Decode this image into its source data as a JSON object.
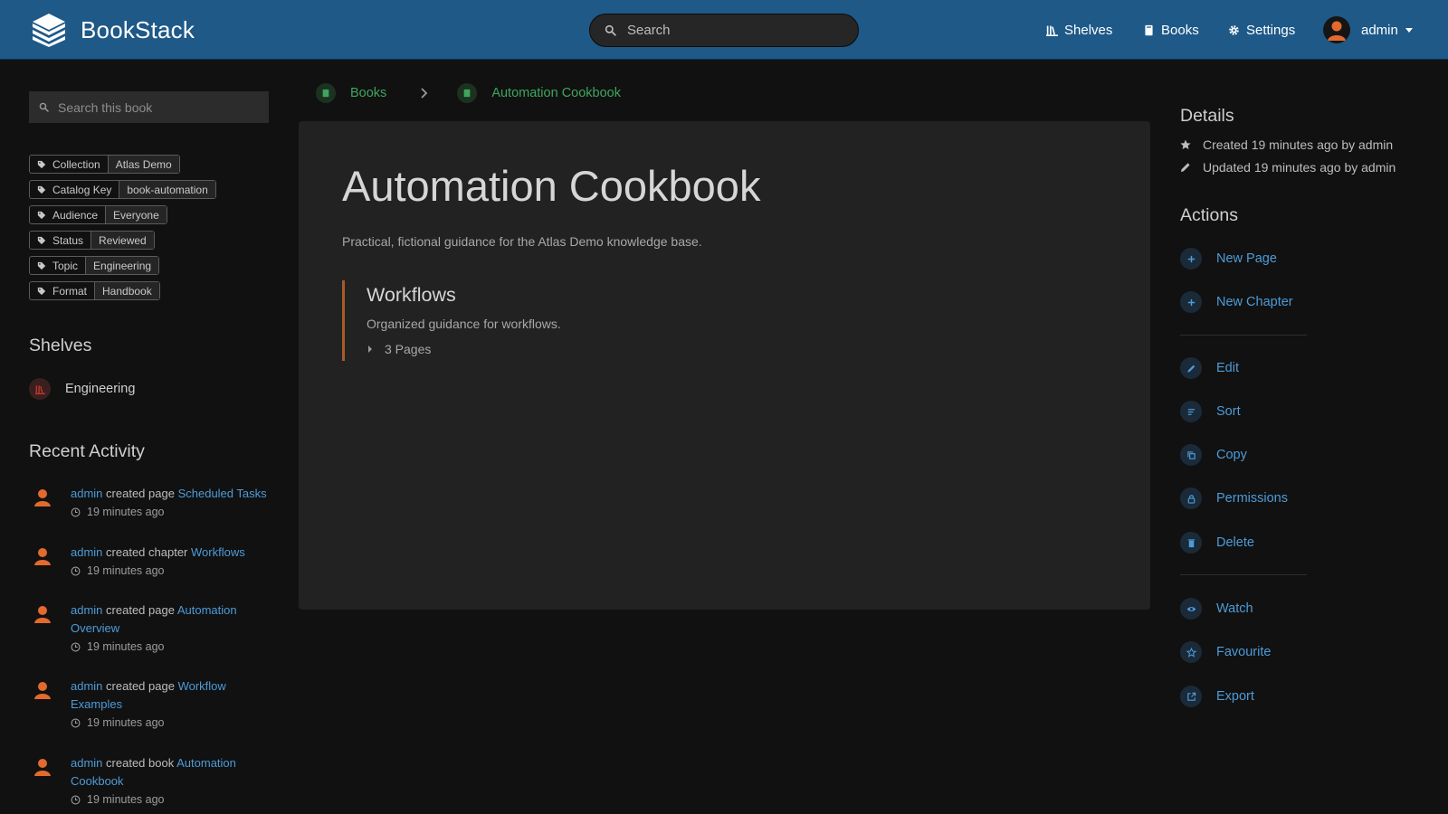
{
  "header": {
    "app_name": "BookStack",
    "search_placeholder": "Search",
    "nav": {
      "shelves": "Shelves",
      "books": "Books",
      "settings": "Settings"
    },
    "user": "admin"
  },
  "left": {
    "search_placeholder": "Search this book",
    "tags": [
      {
        "name": "Collection",
        "value": "Atlas Demo"
      },
      {
        "name": "Catalog Key",
        "value": "book-automation"
      },
      {
        "name": "Audience",
        "value": "Everyone"
      },
      {
        "name": "Status",
        "value": "Reviewed"
      },
      {
        "name": "Topic",
        "value": "Engineering"
      },
      {
        "name": "Format",
        "value": "Handbook"
      }
    ],
    "shelves_title": "Shelves",
    "shelves": [
      {
        "label": "Engineering"
      }
    ],
    "recent_title": "Recent Activity",
    "activity": [
      {
        "user": "admin",
        "action": "created page",
        "target": "Scheduled Tasks",
        "time": "19 minutes ago"
      },
      {
        "user": "admin",
        "action": "created chapter",
        "target": "Workflows",
        "time": "19 minutes ago"
      },
      {
        "user": "admin",
        "action": "created page",
        "target": "Automation Overview",
        "time": "19 minutes ago"
      },
      {
        "user": "admin",
        "action": "created page",
        "target": "Workflow Examples",
        "time": "19 minutes ago"
      },
      {
        "user": "admin",
        "action": "created book",
        "target": "Automation Cookbook",
        "time": "19 minutes ago"
      }
    ]
  },
  "breadcrumb": {
    "books": "Books",
    "current": "Automation Cookbook"
  },
  "main": {
    "title": "Automation Cookbook",
    "description": "Practical, fictional guidance for the Atlas Demo knowledge base.",
    "chapter": {
      "title": "Workflows",
      "description": "Organized guidance for workflows.",
      "pages_toggle": "3 Pages"
    }
  },
  "right": {
    "details_title": "Details",
    "created": "Created 19 minutes ago by admin",
    "updated": "Updated 19 minutes ago by admin",
    "actions_title": "Actions",
    "actions": {
      "new_page": "New Page",
      "new_chapter": "New Chapter",
      "edit": "Edit",
      "sort": "Sort",
      "copy": "Copy",
      "permissions": "Permissions",
      "delete": "Delete",
      "watch": "Watch",
      "favourite": "Favourite",
      "export": "Export"
    }
  },
  "colors": {
    "header_bg": "#1e5988",
    "page_bg": "#111111",
    "card_bg": "#222222",
    "link": "#4d9bd8",
    "book_green": "#3fa55e",
    "chapter_orange": "#a85a26",
    "avatar_orange": "#e36a2e"
  }
}
